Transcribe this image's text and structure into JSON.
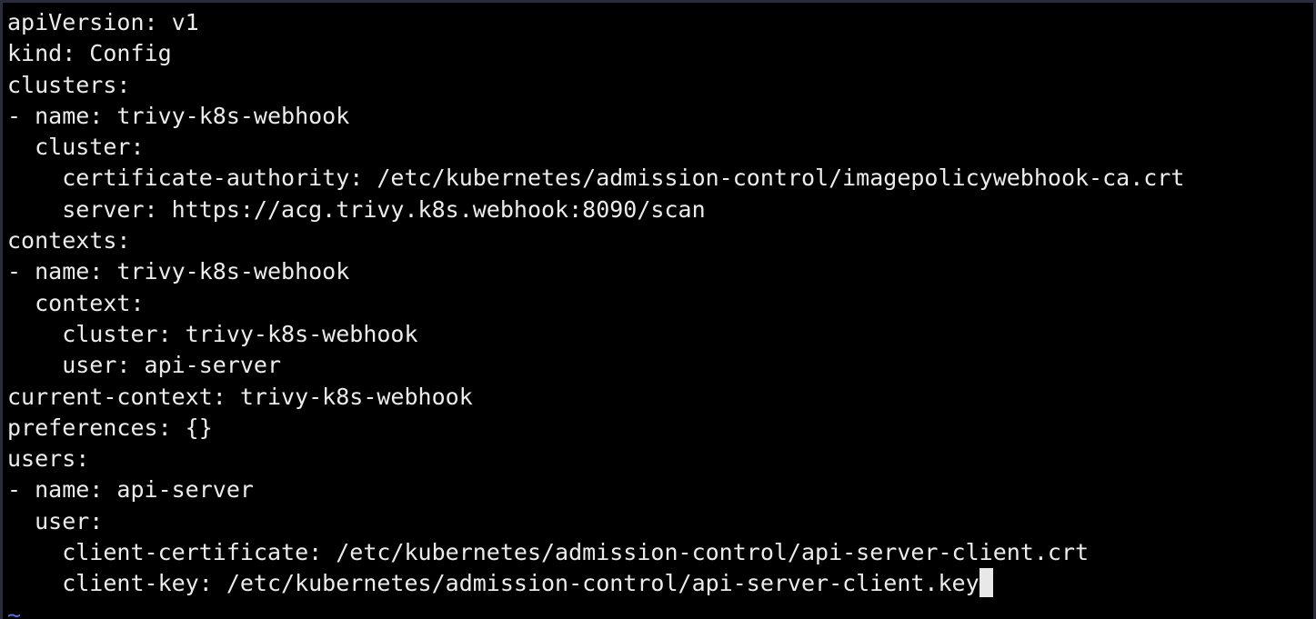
{
  "editor": {
    "lines": [
      "apiVersion: v1",
      "kind: Config",
      "clusters:",
      "- name: trivy-k8s-webhook",
      "  cluster:",
      "    certificate-authority: /etc/kubernetes/admission-control/imagepolicywebhook-ca.crt",
      "    server: https://acg.trivy.k8s.webhook:8090/scan",
      "contexts:",
      "- name: trivy-k8s-webhook",
      "  context:",
      "    cluster: trivy-k8s-webhook",
      "    user: api-server",
      "current-context: trivy-k8s-webhook",
      "preferences: {}",
      "users:",
      "- name: api-server",
      "  user:",
      "    client-certificate: /etc/kubernetes/admission-control/api-server-client.crt",
      "    client-key: /etc/kubernetes/admission-control/api-server-client.key"
    ],
    "empty_line_marker": "~"
  },
  "colors": {
    "background": "#000000",
    "text": "#ececec",
    "cursor": "#e8e8e8",
    "tilde": "#5a6cf0",
    "frame": "#2a2b3b"
  }
}
